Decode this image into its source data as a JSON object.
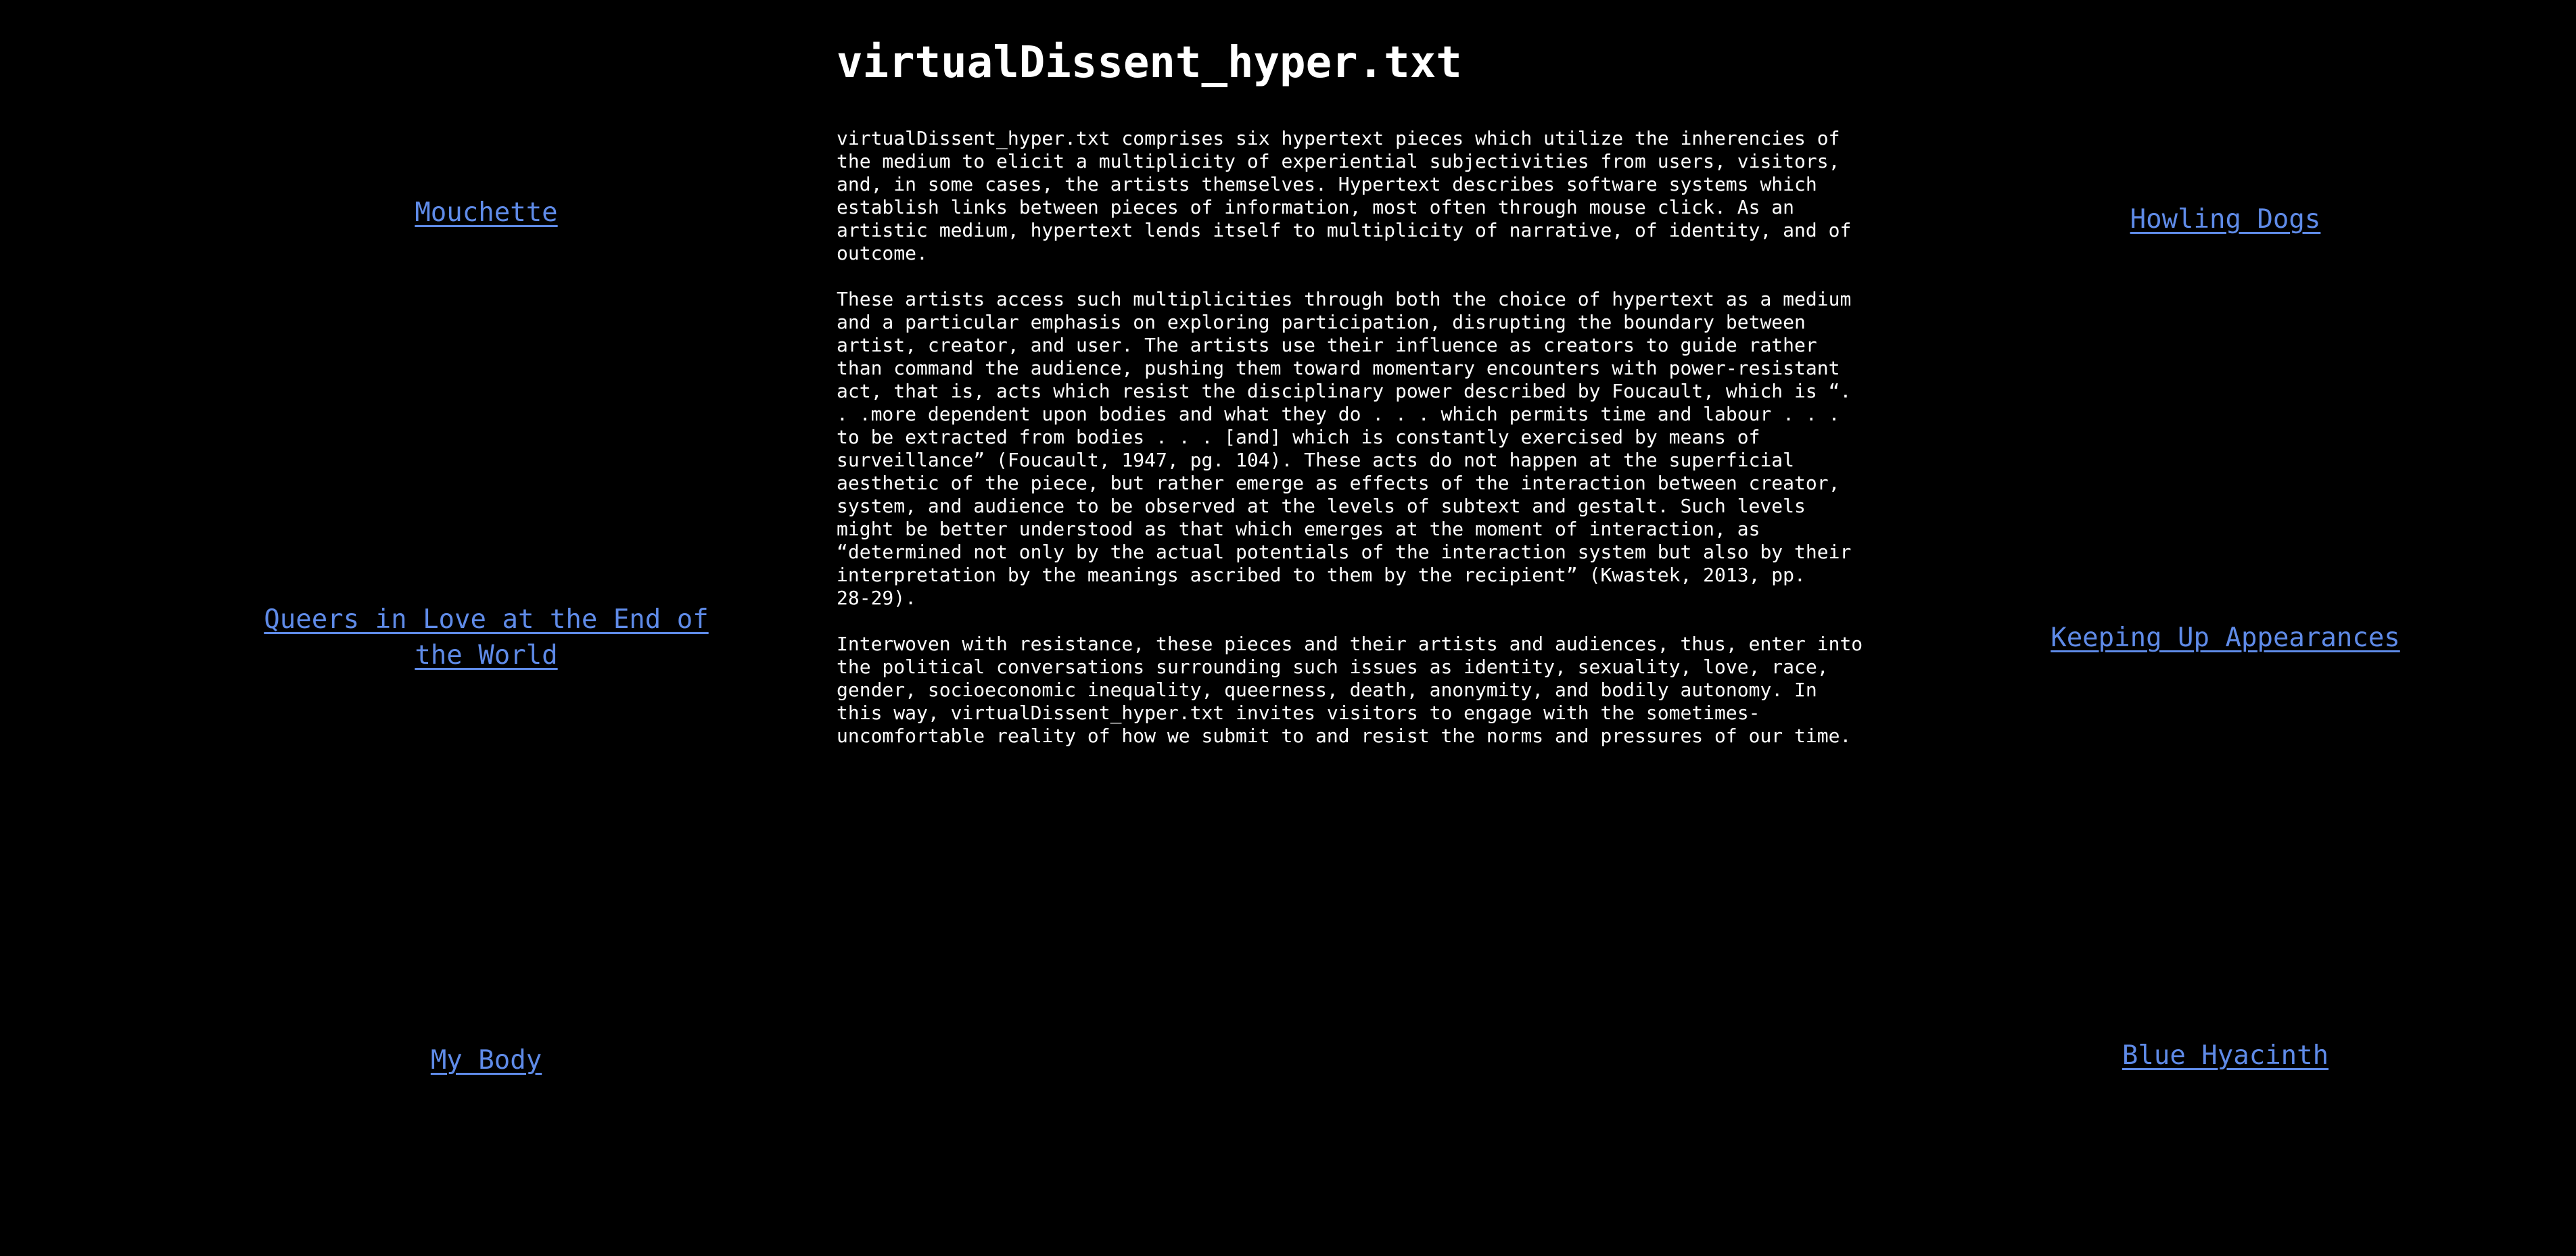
{
  "page": {
    "title": "virtualDissent_hyper.txt",
    "paragraphs": [
      "virtualDissent_hyper.txt comprises six hypertext pieces which utilize the inherencies of\nthe medium to elicit a multiplicity of experiential subjectivities from users, visitors,\nand, in some cases, the artists themselves. Hypertext describes software systems which\nestablish links between pieces of information, most often through mouse click. As an\nartistic medium, hypertext lends itself to multiplicity of narrative, of identity, and of\noutcome.",
      "These artists access such multiplicities through both the choice of hypertext as a medium\nand a particular emphasis on exploring participation, disrupting the boundary between\nartist, creator, and user. The artists use their influence as creators to guide rather\nthan command the audience, pushing them toward momentary encounters with power-resistant\nact, that is, acts which resist the disciplinary power described by Foucault, which is “.\n. .more dependent upon bodies and what they do . . . which permits time and labour . . .\nto be extracted from bodies . . . [and] which is constantly exercised by means of\nsurveillance” (Foucault, 1947, pg. 104). These acts do not happen at the superficial\naesthetic of the piece, but rather emerge as effects of the interaction between creator,\nsystem, and audience to be observed at the levels of subtext and gestalt. Such levels\nmight be better understood as that which emerges at the moment of interaction, as\n“determined not only by the actual potentials of the interaction system but also by their\ninterpretation by the meanings ascribed to them by the recipient” (Kwastek, 2013, pp.\n28-29).",
      "Interwoven with resistance, these pieces and their artists and audiences, thus, enter into\nthe political conversations surrounding such issues as identity, sexuality, love, race,\ngender, socioeconomic inequality, queerness, death, anonymity, and bodily autonomy. In\nthis way, virtualDissent_hyper.txt invites visitors to engage with the sometimes-\nuncomfortable reality of how we submit to and resist the norms and pressures of our time."
    ]
  },
  "links": {
    "left": [
      "Mouchette",
      "Queers in Love at the End of\nthe World",
      "My Body"
    ],
    "right": [
      "Howling Dogs",
      "Keeping Up Appearances",
      "Blue Hyacinth"
    ]
  },
  "colors": {
    "background": "#000000",
    "text": "#ffffff",
    "link": "#5f8be8"
  }
}
